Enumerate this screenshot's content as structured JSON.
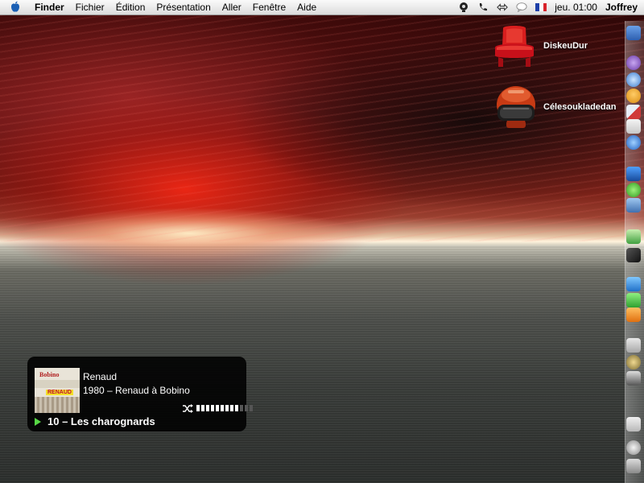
{
  "menubar": {
    "app_name": "Finder",
    "menus": [
      "Fichier",
      "Édition",
      "Présentation",
      "Aller",
      "Fenêtre",
      "Aide"
    ],
    "clock": "jeu. 01:00",
    "user": "Joffrey",
    "icons": [
      "apple-icon",
      "monitor-icon",
      "phone-icon",
      "sync-icon",
      "speech-bubble-icon",
      "french-flag-icon"
    ]
  },
  "desktop": {
    "icons": [
      {
        "label": "DiskeuDur",
        "icon": "red-chair-icon"
      },
      {
        "label": "Célesoukladedan",
        "icon": "helmet-icon"
      }
    ]
  },
  "dock": {
    "items": [
      "finder-icon",
      "itunes-icon",
      "safari-icon",
      "adium-icon",
      "mail-icon",
      "address-book-icon",
      "network-icon",
      "chat-icon",
      "skype-icon",
      "preview-icon",
      "music-icon",
      "grapher-icon",
      "app-icon-blue",
      "app-icon-green",
      "app-icon-orange",
      "system-preferences-icon",
      "x11-icon",
      "utility-icon",
      "folder-icon",
      "spotlight-icon",
      "trash-icon"
    ]
  },
  "player": {
    "artist": "Renaud",
    "album": "1980 – Renaud à Bobino",
    "track": "10 – Les charognards",
    "album_art_text": "RENAUD",
    "album_art_header": "Bobino",
    "volume": 0.75,
    "shuffle": true
  }
}
